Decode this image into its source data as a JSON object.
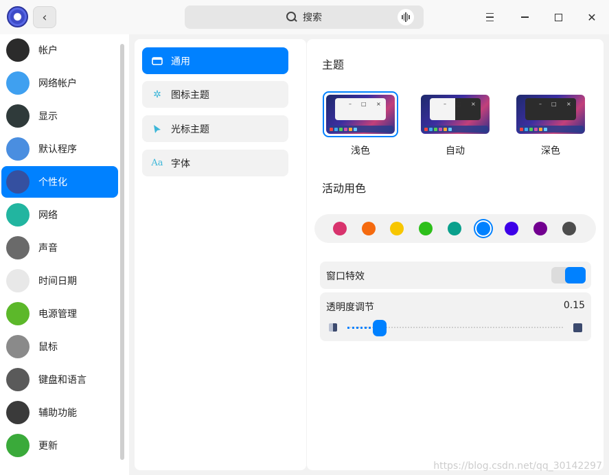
{
  "search": {
    "label": "搜索"
  },
  "sidebar": {
    "items": [
      {
        "label": "帐户",
        "color": "#2b2b2b",
        "icon": "account-icon"
      },
      {
        "label": "网络帐户",
        "color": "#3fa0f0",
        "icon": "cloud-icon"
      },
      {
        "label": "显示",
        "color": "#2f3a3a",
        "icon": "display-icon"
      },
      {
        "label": "默认程序",
        "color": "#4a8ee0",
        "icon": "default-apps-icon"
      },
      {
        "label": "个性化",
        "color": "#3550a0",
        "icon": "personalization-icon",
        "active": true
      },
      {
        "label": "网络",
        "color": "#22b5a0",
        "icon": "network-icon"
      },
      {
        "label": "声音",
        "color": "#6a6a6a",
        "icon": "speaker-icon"
      },
      {
        "label": "时间日期",
        "color": "#e8e8e8",
        "icon": "clock-icon"
      },
      {
        "label": "电源管理",
        "color": "#5cb82a",
        "icon": "battery-icon"
      },
      {
        "label": "鼠标",
        "color": "#8a8a8a",
        "icon": "mouse-icon"
      },
      {
        "label": "键盘和语言",
        "color": "#5a5a5a",
        "icon": "keyboard-icon"
      },
      {
        "label": "辅助功能",
        "color": "#3a3a3a",
        "icon": "microphone-icon"
      },
      {
        "label": "更新",
        "color": "#3aaa3a",
        "icon": "update-icon"
      }
    ]
  },
  "subnav": {
    "items": [
      {
        "label": "通用",
        "active": true,
        "icon": "window-icon"
      },
      {
        "label": "图标主题",
        "icon": "icon-theme-icon"
      },
      {
        "label": "光标主题",
        "icon": "cursor-icon"
      },
      {
        "label": "字体",
        "icon": "font-icon",
        "glyph": "Aa"
      }
    ]
  },
  "theme": {
    "title": "主题",
    "options": [
      {
        "label": "浅色",
        "selected": true
      },
      {
        "label": "自动"
      },
      {
        "label": "深色"
      }
    ],
    "window_controls": {
      "min": "–",
      "max": "□",
      "close": "×"
    }
  },
  "accent": {
    "title": "活动用色",
    "colors": [
      "#d8336d",
      "#f56a0f",
      "#f7c600",
      "#2dbf1a",
      "#0aa08c",
      "#0081ff",
      "#3d00e8",
      "#720090",
      "#4d4d4d"
    ],
    "selected_index": 5
  },
  "window_effects": {
    "label": "窗口特效",
    "enabled": true
  },
  "transparency": {
    "label": "透明度调节",
    "value": "0.15",
    "fraction": 0.15
  },
  "watermark": "https://blog.csdn.net/qq_30142297"
}
